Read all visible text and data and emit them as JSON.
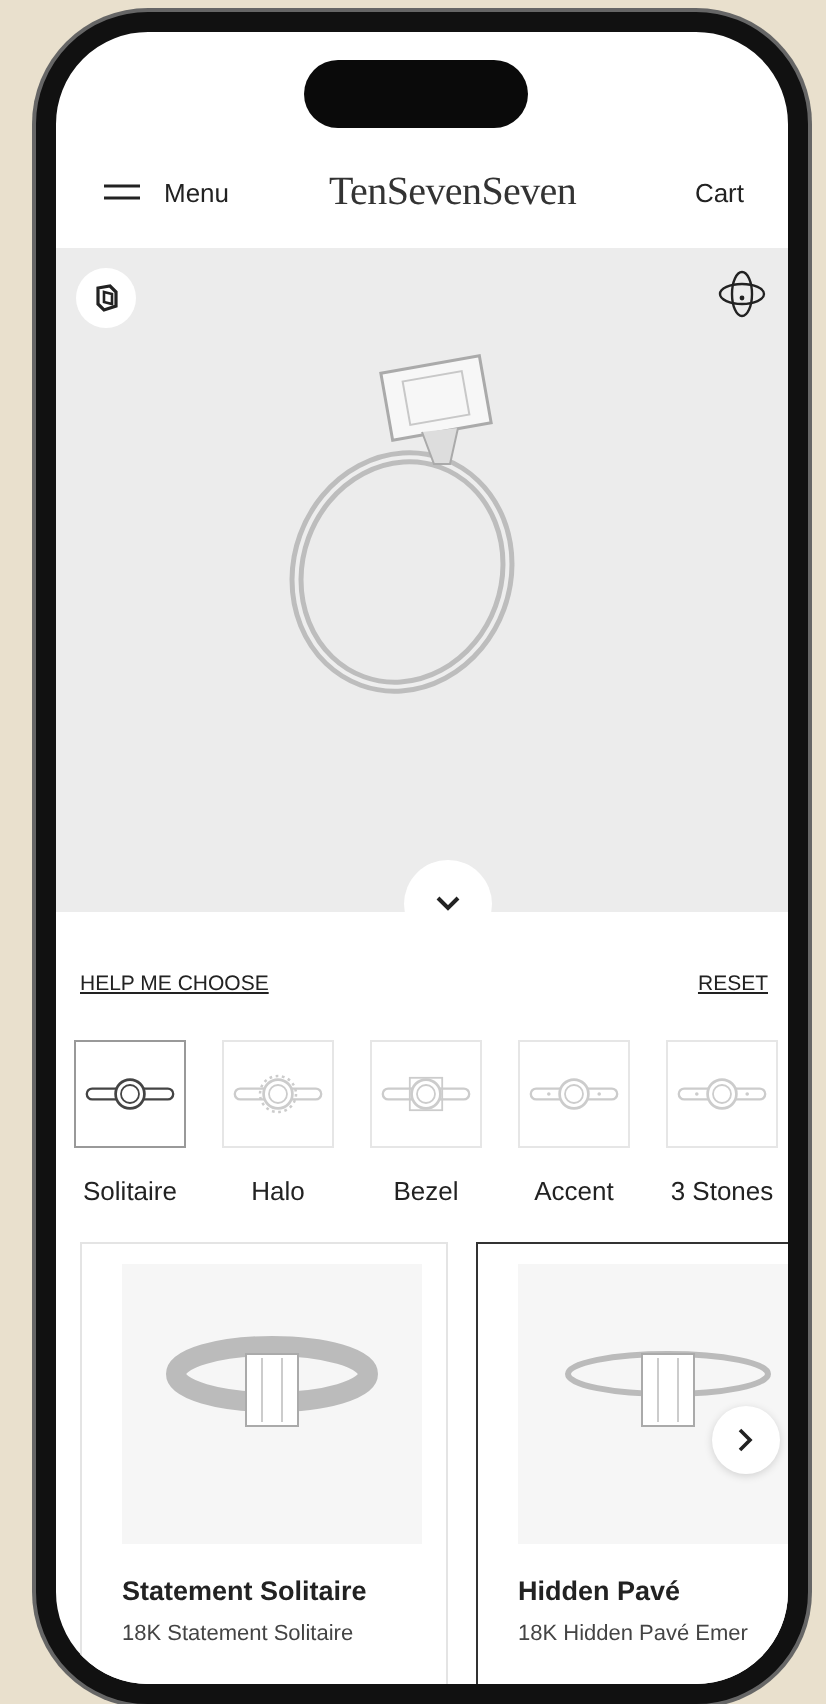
{
  "header": {
    "menu_label": "Menu",
    "logo": "TenSevenSeven",
    "cart": "Cart"
  },
  "help_link": "HELP ME CHOOSE",
  "reset_link": "RESET",
  "styles": [
    {
      "label": "Solitaire",
      "selected": true
    },
    {
      "label": "Halo",
      "selected": false
    },
    {
      "label": "Bezel",
      "selected": false
    },
    {
      "label": "Accent",
      "selected": false
    },
    {
      "label": "3 Stones",
      "selected": false
    }
  ],
  "cards": [
    {
      "title": "Statement Solitaire",
      "subtitle": "18K Statement Solitaire",
      "selected": false
    },
    {
      "title": "Hidden Pavé",
      "subtitle": "18K Hidden Pavé Emer",
      "selected": true
    }
  ]
}
